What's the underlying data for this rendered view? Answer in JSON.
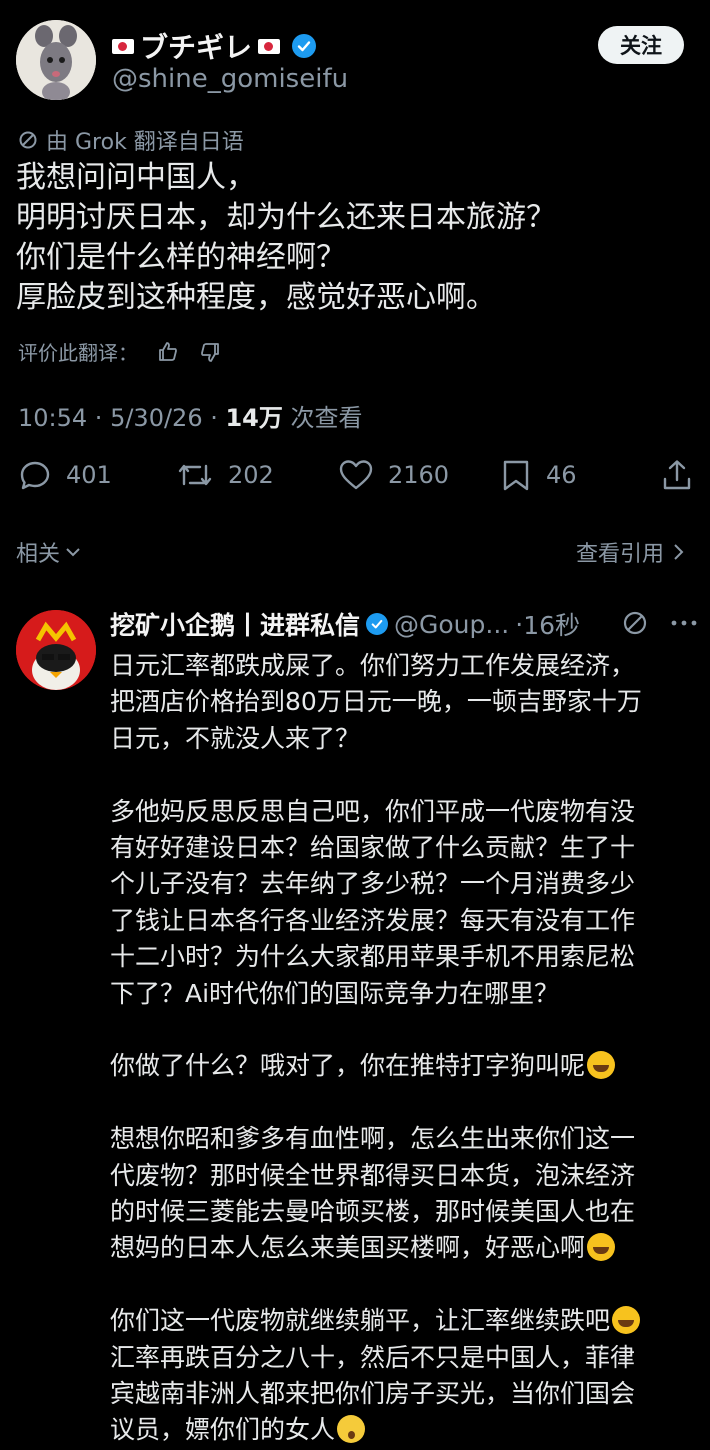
{
  "author": {
    "display_name": "ブチギレ",
    "handle": "@shine_gomiseifu",
    "follow_label": "关注"
  },
  "translation_note": "由 Grok 翻译自日语",
  "tweet_lines": [
    "我想问问中国人，",
    "明明讨厌日本，却为什么还来日本旅游？",
    "你们是什么样的神经啊？",
    "厚脸皮到这种程度，感觉好恶心啊。"
  ],
  "rate_translation_label": "评价此翻译：",
  "meta": {
    "time": "10:54",
    "date": "5/30/26",
    "views_count": "14万",
    "views_label": "次查看"
  },
  "actions": {
    "replies": "401",
    "reposts": "202",
    "likes": "2160",
    "bookmarks": "46"
  },
  "related_label": "相关",
  "view_quotes_label": "查看引用",
  "reply": {
    "name": "挖矿小企鹅丨进群私信",
    "handle": "@Goup...",
    "time": "16秒",
    "lines": [
      "日元汇率都跌成屎了。你们努力工作发展经济，",
      "把酒店价格抬到80万日元一晚，一顿吉野家十万",
      "日元，不就没人来了？",
      "",
      "多他妈反思反思自己吧，你们平成一代废物有没",
      "有好好建设日本？给国家做了什么贡献？生了十",
      "个儿子没有？去年纳了多少税？一个月消费多少",
      "了钱让日本各行各业经济发展？每天有没有工作",
      "十二小时？为什么大家都用苹果手机不用索尼松",
      "下了？Ai时代你们的国际竞争力在哪里？",
      "",
      "你做了什么？哦对了，你在推特打字狗叫呢",
      "",
      "想想你昭和爹多有血性啊，怎么生出来你们这一",
      "代废物？那时候全世界都得买日本货，泡沫经济",
      "的时候三菱能去曼哈顿买楼，那时候美国人也在",
      "想妈的日本人怎么来美国买楼啊，好恶心啊",
      "",
      "你们这一代废物就继续躺平，让汇率继续跌吧",
      "汇率再跌百分之八十，然后不只是中国人，菲律",
      "宾越南非洲人都来把你们房子买光，当你们国会",
      "议员，嫖你们的女人"
    ]
  },
  "colors": {
    "background": "#000000",
    "text": "#e7e9ea",
    "secondary": "#8b98a5",
    "verified": "#1d9bf0"
  }
}
